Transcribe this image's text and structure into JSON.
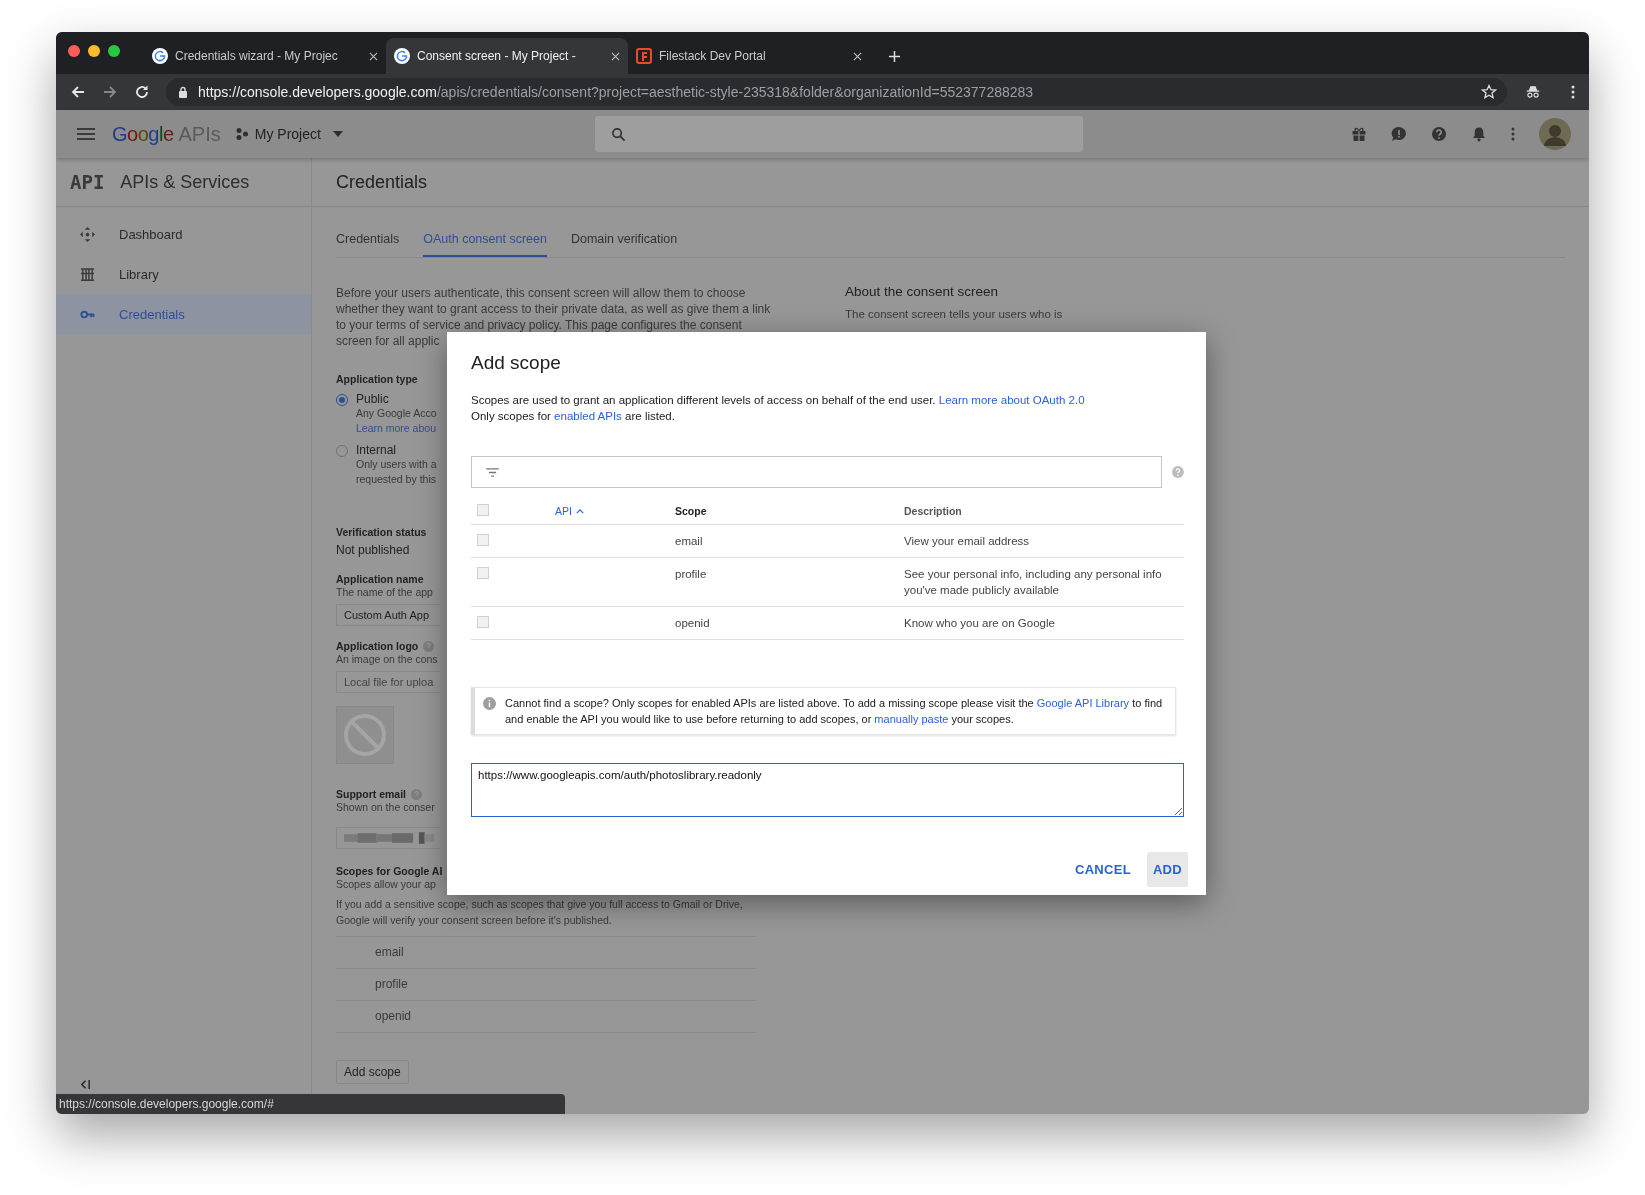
{
  "browser": {
    "tabs": [
      {
        "title": "Credentials wizard - My Projec",
        "kind": "google",
        "selected": false
      },
      {
        "title": "Consent screen - My Project -",
        "kind": "google",
        "selected": true
      },
      {
        "title": "Filestack Dev Portal",
        "kind": "filestack",
        "selected": false
      }
    ],
    "address": {
      "host": "https://console.developers.google.com",
      "path": "/apis/credentials/consent?project=aesthetic-style-235318&folder&organizationId=552377288283"
    }
  },
  "header": {
    "logo": "Google",
    "product": "APIs",
    "project": "My Project"
  },
  "sidebar": {
    "logo": "API",
    "title": "APIs & Services",
    "items": [
      {
        "label": "Dashboard",
        "kind": "dashboard",
        "selected": false
      },
      {
        "label": "Library",
        "kind": "library",
        "selected": false
      },
      {
        "label": "Credentials",
        "kind": "credentials",
        "selected": true
      }
    ]
  },
  "page": {
    "title": "Credentials",
    "tabs": [
      {
        "label": "Credentials",
        "selected": false
      },
      {
        "label": "OAuth consent screen",
        "selected": true
      },
      {
        "label": "Domain verification",
        "selected": false
      }
    ],
    "intro_lines": [
      "Before your users authenticate, this consent screen will allow them to choose",
      "whether they want to grant access to their private data, as well as give them a link",
      "to your terms of service and privacy policy. This page configures the consent",
      "screen for all applic"
    ],
    "application_type": {
      "label": "Application type",
      "options": [
        {
          "label": "Public",
          "selected": true,
          "lines": [
            "Any Google Acco"
          ],
          "link": "Learn more abou"
        },
        {
          "label": "Internal",
          "selected": false,
          "lines": [
            "Only users with a",
            "requested by this"
          ]
        }
      ]
    },
    "verification": {
      "label": "Verification status",
      "value": "Not published"
    },
    "app_name": {
      "label": "Application name",
      "hint": "The name of the app",
      "value": "Custom Auth App"
    },
    "app_logo": {
      "label": "Application logo",
      "hint": "An image on the cons",
      "placeholder": "Local file for uploa"
    },
    "support_email": {
      "label": "Support email",
      "hint": "Shown on the conser"
    },
    "scopes": {
      "label": "Scopes for Google AI",
      "hint": "Scopes allow your ap",
      "note": "If you add a sensitive scope, such as scopes that give you full access to Gmail or Drive, Google will verify your consent screen before it's published.",
      "items": [
        "email",
        "profile",
        "openid"
      ],
      "button": "Add scope"
    },
    "about": {
      "title": "About the consent screen",
      "text": "The consent screen tells your users who is"
    }
  },
  "dialog": {
    "title": "Add scope",
    "description": [
      [
        {
          "kind": "text",
          "text": "Scopes are used to grant an application different levels of access on behalf of the end user. "
        },
        {
          "kind": "link",
          "text": "Learn more about OAuth 2.0"
        }
      ],
      [
        {
          "kind": "text",
          "text": "Only scopes for "
        },
        {
          "kind": "link",
          "text": "enabled APIs"
        },
        {
          "kind": "text",
          "text": " are listed."
        }
      ]
    ],
    "select_all": {
      "checked": false
    },
    "columns": [
      {
        "label": "API",
        "sorted": true
      },
      {
        "label": "Scope",
        "sorted": false
      },
      {
        "label": "Description",
        "sorted": false
      }
    ],
    "rows": [
      {
        "checked": false,
        "scope": "email",
        "description": "View your email address"
      },
      {
        "checked": false,
        "scope": "profile",
        "description": "See your personal info, including any personal info you've made publicly available"
      },
      {
        "checked": false,
        "scope": "openid",
        "description": "Know who you are on Google"
      }
    ],
    "info": [
      {
        "kind": "text",
        "text": "Cannot find a scope? Only scopes for enabled APIs are listed above. To add a missing scope please visit the "
      },
      {
        "kind": "link",
        "text": "Google API Library"
      },
      {
        "kind": "text",
        "text": " to find and enable the API you would like to use before returning to add scopes, or "
      },
      {
        "kind": "link",
        "text": "manually paste"
      },
      {
        "kind": "text",
        "text": " your scopes."
      }
    ],
    "textarea": {
      "value": "https://www.googleapis.com/auth/photoslibrary.readonly",
      "focused": true
    },
    "buttons": [
      {
        "label": "CANCEL",
        "focused": false
      },
      {
        "label": "ADD",
        "focused": true
      }
    ]
  },
  "status_url": "https://console.developers.google.com/#"
}
